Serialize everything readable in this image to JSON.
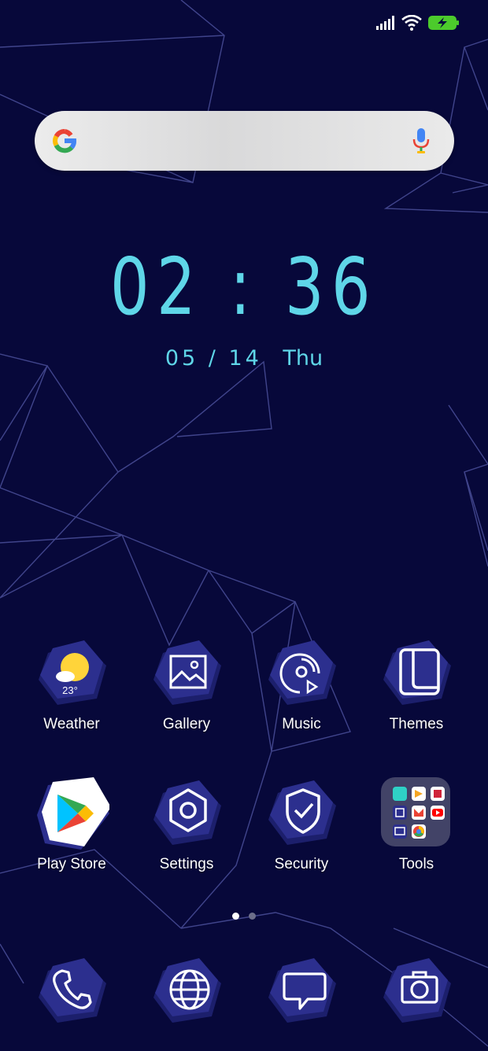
{
  "status_bar": {
    "signal_icon": "signal-bars-icon",
    "wifi_icon": "wifi-icon",
    "battery_icon": "battery-charging-icon",
    "battery_color": "#4ccb2c"
  },
  "search": {
    "logo_icon": "google-g-icon",
    "mic_icon": "microphone-icon"
  },
  "clock": {
    "time": "02 : 36",
    "date": "05 / 14",
    "day": "Thu",
    "color": "#5fd6e8"
  },
  "apps_row1": [
    {
      "label": "Weather",
      "icon": "weather-sun-icon",
      "temp": "23°"
    },
    {
      "label": "Gallery",
      "icon": "gallery-image-icon"
    },
    {
      "label": "Music",
      "icon": "music-disc-icon"
    },
    {
      "label": "Themes",
      "icon": "themes-icon"
    }
  ],
  "apps_row2": [
    {
      "label": "Play Store",
      "icon": "play-store-icon"
    },
    {
      "label": "Settings",
      "icon": "settings-hexagon-icon"
    },
    {
      "label": "Security",
      "icon": "security-shield-icon"
    },
    {
      "label": "Tools",
      "icon": "tools-folder-icon"
    }
  ],
  "dock": [
    {
      "icon": "phone-icon"
    },
    {
      "icon": "browser-globe-icon"
    },
    {
      "icon": "messages-icon"
    },
    {
      "icon": "camera-icon"
    }
  ],
  "page_indicator": {
    "pages": 2,
    "active": 1
  },
  "colors": {
    "background": "#07083a",
    "icon_hex": "#2c2f8e",
    "icon_hex_shadow": "#1c1f6c"
  }
}
